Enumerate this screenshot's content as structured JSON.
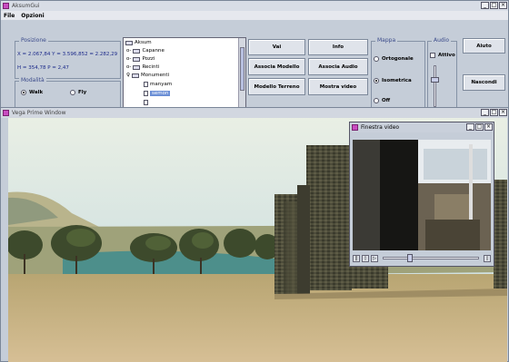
{
  "main_window": {
    "title": "AksumGui",
    "menu": [
      "File",
      "Opzioni"
    ]
  },
  "position": {
    "legend": "Posizione",
    "coords": "X = 2.067,84 Y = 3.596,852 = 2.282,29",
    "h_p": "H = 354,78   P = 2,47"
  },
  "mode": {
    "legend": "Modalità",
    "options": [
      {
        "label": "Walk",
        "selected": true
      },
      {
        "label": "Fly",
        "selected": false
      }
    ]
  },
  "tree": {
    "items": [
      {
        "label": "Aksum",
        "type": "folder",
        "level": 0
      },
      {
        "label": "Capanne",
        "type": "folder",
        "level": 1
      },
      {
        "label": "Pozzi",
        "type": "folder",
        "level": 1
      },
      {
        "label": "Recinti",
        "type": "folder",
        "level": 1
      },
      {
        "label": "Monumenti",
        "type": "folder",
        "level": 1
      },
      {
        "label": "manyam",
        "type": "leaf",
        "level": 2
      },
      {
        "label": "semon",
        "type": "leaf",
        "level": 2,
        "selected": true
      }
    ]
  },
  "actions": {
    "vai": "Vai",
    "info": "Info",
    "associa_modello": "Associa Modello",
    "associa_audio": "Associa Audio",
    "modello_terreno": "Modello Terreno",
    "mostra_video": "Mostra video"
  },
  "mappa": {
    "legend": "Mappa",
    "options": [
      {
        "label": "Ortogonale",
        "selected": false
      },
      {
        "label": "Isometrica",
        "selected": true
      },
      {
        "label": "Off",
        "selected": false
      }
    ]
  },
  "audio": {
    "legend": "Audio",
    "attivo_label": "Attivo",
    "attivo_checked": false,
    "volume": 0.7
  },
  "side_buttons": {
    "aiuto": "Aiuto",
    "nascondi": "Nascondi"
  },
  "viewer_window": {
    "title": "Vega Prime Window"
  },
  "video_window": {
    "title": "Finestra video",
    "playback_position": 0.25
  },
  "colors": {
    "window_bg": "#c5cdd8",
    "legend_text": "#3a4a8a",
    "readout_text": "#1c2a8a",
    "selection": "#6b8fd6"
  }
}
